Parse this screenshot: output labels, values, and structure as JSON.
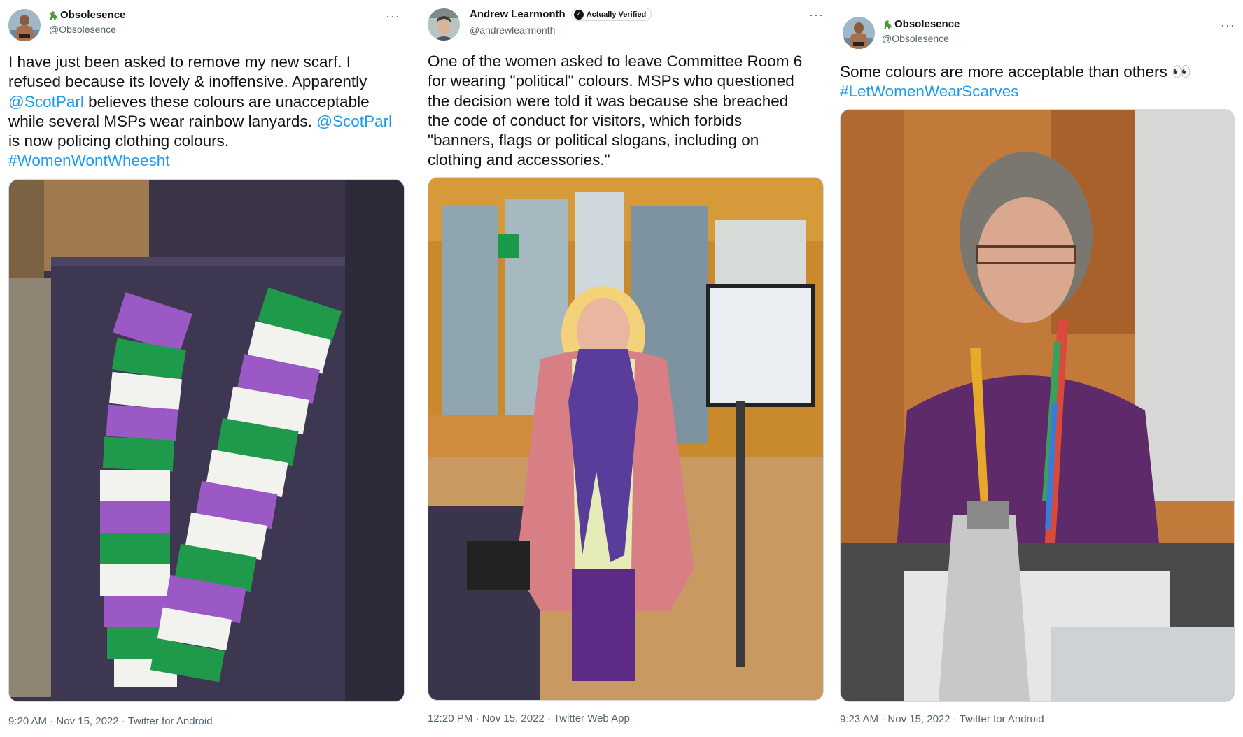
{
  "tweets": [
    {
      "author": {
        "name": "Obsolesence",
        "handle": "@Obsolesence"
      },
      "text": {
        "line1": "I have just been asked to remove my new scarf. I",
        "line2": "refused because its lovely & inoffensive. Apparently",
        "mention1": "@ScotParl",
        "line3_after": " believes these colours are unacceptable",
        "line4_before": "while several MSPs wear rainbow lanyards. ",
        "mention2": "@ScotParl",
        "line5": "is now policing clothing colours.",
        "hashtag": "#WomenWontWheesht"
      },
      "media_icon": "green-purple-white-striped-scarf-on-chair",
      "time": "9:20 AM",
      "date": "Nov 15, 2022",
      "source": "Twitter for Android"
    },
    {
      "author": {
        "name": "Andrew Learmonth",
        "handle": "@andrewlearmonth",
        "badge": "Actually Verified"
      },
      "text": {
        "line1": "One of the women asked to leave Committee Room 6",
        "line2": "for wearing \"political\" colours. MSPs who questioned",
        "line3": "the decision were told it was because she breached",
        "line4": "the code of conduct for visitors, which forbids",
        "line5": "\"banners, flags or political slogans, including on",
        "line6": "clothing and accessories.\""
      },
      "media_icon": "woman-in-pink-coat-and-purple-scarf-photo",
      "time": "12:20 PM",
      "date": "Nov 15, 2022",
      "source": "Twitter Web App"
    },
    {
      "author": {
        "name": "Obsolesence",
        "handle": "@Obsolesence"
      },
      "text": {
        "line1": "Some colours are more acceptable than others 👀",
        "hashtag": "#LetWomenWearScarves"
      },
      "media_icon": "msp-with-rainbow-lanyard-photo",
      "time": "9:23 AM",
      "date": "Nov 15, 2022",
      "source": "Twitter for Android"
    }
  ],
  "separator": " · ",
  "more_glyph": "···",
  "colors": {
    "link": "#1d9bf0",
    "text": "#0f1419",
    "muted": "#536471",
    "scarf_purple": "#9b59c6",
    "scarf_green": "#1f9a4b",
    "scarf_white": "#f2f2ee"
  }
}
